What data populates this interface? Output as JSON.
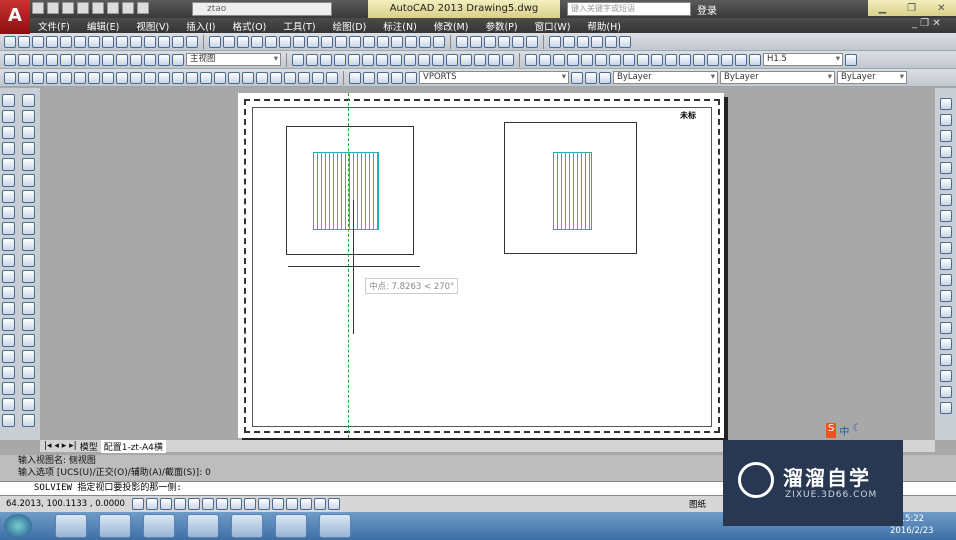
{
  "app": {
    "title": "AutoCAD 2013    Drawing5.dwg",
    "workspace": "ztao",
    "search_placeholder": "键入关键字或短语",
    "login": "登录",
    "logo": "A"
  },
  "menu": [
    "文件(F)",
    "编辑(E)",
    "视图(V)",
    "插入(I)",
    "格式(O)",
    "工具(T)",
    "绘图(D)",
    "标注(N)",
    "修改(M)",
    "参数(P)",
    "窗口(W)",
    "帮助(H)"
  ],
  "toolbars": {
    "view_combo": "主视图",
    "text_style_combo": "H1.5",
    "layer_combo": "VPORTS",
    "color_combo": "ByLayer",
    "linetype_combo": "ByLayer",
    "lineweight_combo": "ByLayer"
  },
  "drawing": {
    "title_block_text": "未标",
    "tooltip": "中点: 7.8263 < 270°",
    "geometry_color": "#1ab0b0"
  },
  "tabs": {
    "model": "模型",
    "layout": "配置1-zt-A4横"
  },
  "command": {
    "history": [
      "输入视图名: 侧视图",
      "输入选项 [UCS(U)/正交(O)/辅助(A)/截面(S)]: 0"
    ],
    "prompt": "SOLVIEW 指定视口要投影的那一侧:"
  },
  "status": {
    "coords": "64.2013,  100.1133 , 0.0000",
    "paper": "图纸"
  },
  "taskbar": {
    "time": "15:22",
    "date": "2016/2/23",
    "apps": [
      "autocad",
      "thunderbird",
      "picasa",
      "app-99",
      "foxit-pdf",
      "scissors",
      "excel"
    ]
  },
  "watermark": {
    "title": "溜溜自学",
    "subtitle": "ZIXUE.3D66.COM"
  },
  "ime": {
    "label": "中"
  }
}
